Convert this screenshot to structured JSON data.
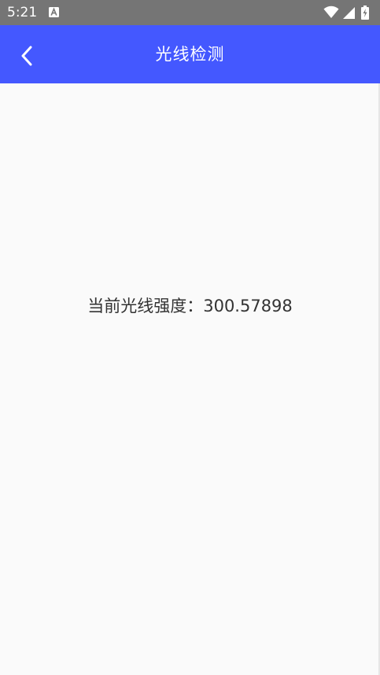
{
  "status_bar": {
    "time": "5:21",
    "icons": [
      "notification-a-icon",
      "wifi-icon",
      "signal-icon",
      "battery-charging-icon"
    ]
  },
  "app_bar": {
    "title": "光线检测",
    "back_icon": "chevron-left-icon",
    "color": "#4458ff"
  },
  "content": {
    "label": "当前光线强度：",
    "value": "300.57898"
  }
}
